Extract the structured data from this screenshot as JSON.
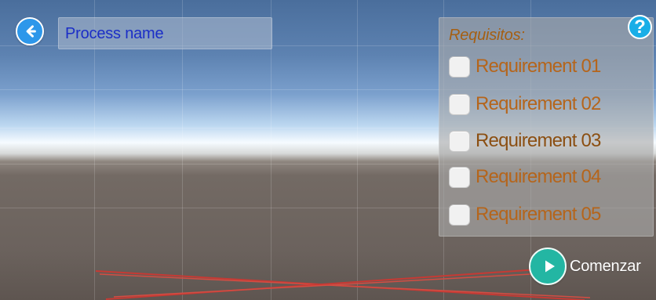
{
  "header": {
    "process_name": "Process name"
  },
  "requirements_panel": {
    "title": "Requisitos:",
    "items": [
      {
        "label": "Requirement 01"
      },
      {
        "label": "Requirement 02"
      },
      {
        "label": "Requirement 03"
      },
      {
        "label": "Requirement 04"
      },
      {
        "label": "Requirement 05"
      }
    ]
  },
  "actions": {
    "help_label": "?",
    "start_label": "Comenzar"
  },
  "icons": {
    "back": "back-arrow-icon",
    "help": "question-mark-icon",
    "play": "play-icon"
  },
  "colors": {
    "back_button": "#2d97ea",
    "help_button": "#19aee7",
    "start_button": "#23b6a3",
    "process_text": "#1b2ec7",
    "requirement_text": "#b5651b",
    "requirement_text_highlight": "#8b4f12"
  }
}
